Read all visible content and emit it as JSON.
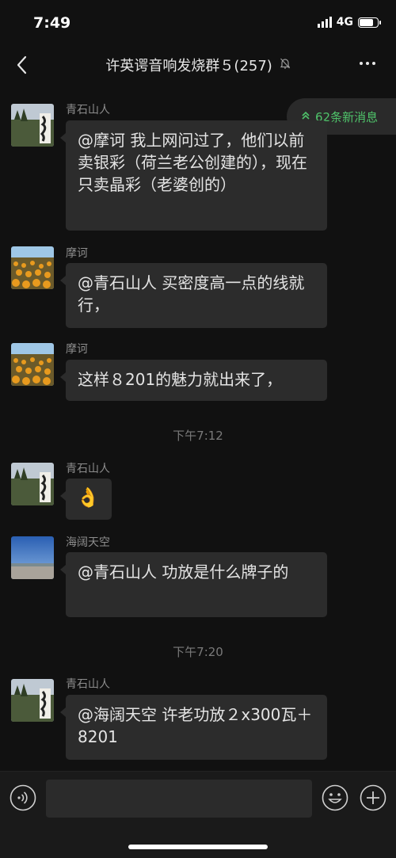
{
  "status_bar": {
    "time": "7:49",
    "network": "4G",
    "battery_level": 0.75
  },
  "header": {
    "title": "许英谔音响发烧群５(257)",
    "back_icon": "chevron-left-icon",
    "mute_icon": "bell-muted-icon",
    "more_icon": "more-dots-icon"
  },
  "new_messages": {
    "label": "62条新消息",
    "icon": "double-chevron-up-icon"
  },
  "messages": [
    {
      "sender": "青石山人",
      "text": "@摩诃 我上网问过了，他们以前卖银彩（荷兰老公创建的），现在只卖晶彩（老婆创的）"
    },
    {
      "sender": "摩诃",
      "text": "@青石山人 买密度高一点的线就行，"
    },
    {
      "sender": "摩诃",
      "text": "这样８201的魅力就出来了，"
    },
    {
      "sender": "青石山人",
      "text": "👌"
    },
    {
      "sender": "海阔天空",
      "text": "@青石山人 功放是什么牌子的"
    },
    {
      "sender": "青石山人",
      "text": "@海阔天空 许老功放２x300瓦＋8201"
    }
  ],
  "timestamps": [
    "下午7:12",
    "下午7:20"
  ],
  "input_bar": {
    "placeholder": "",
    "voice_icon": "voice-icon",
    "emoji_icon": "emoji-icon",
    "plus_icon": "plus-icon"
  }
}
